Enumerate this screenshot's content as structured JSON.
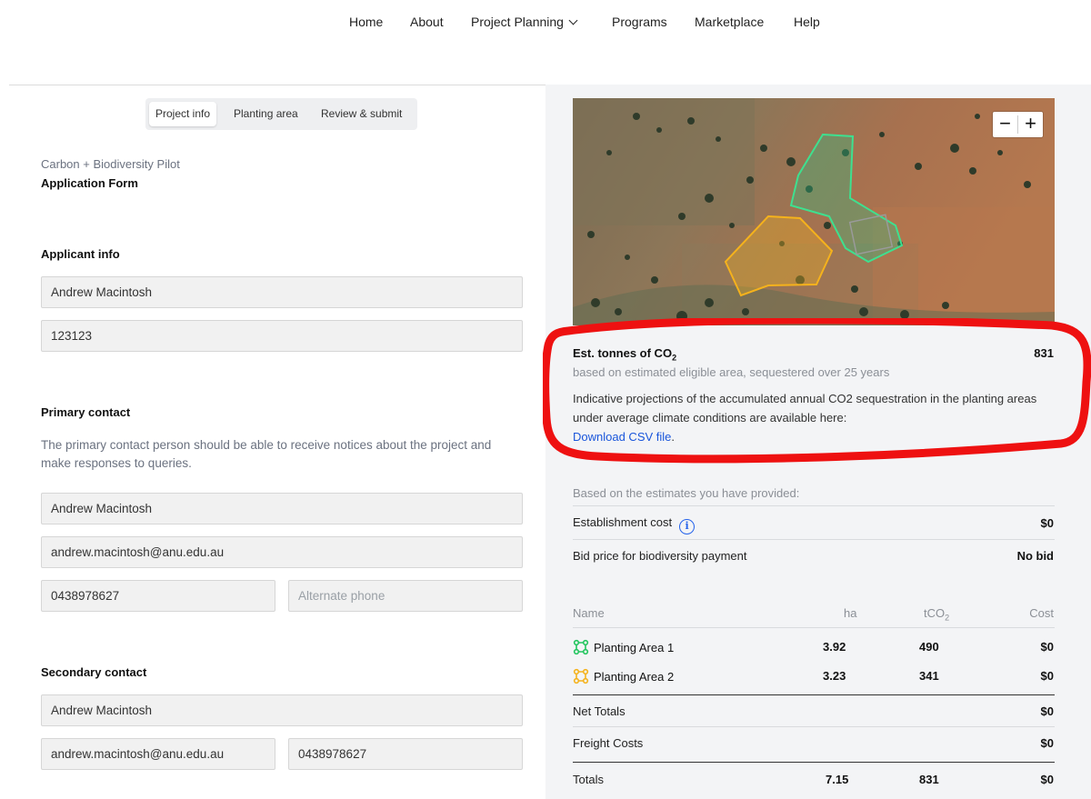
{
  "nav": {
    "home": "Home",
    "about": "About",
    "project_planning": "Project Planning",
    "programs": "Programs",
    "marketplace": "Marketplace",
    "help": "Help"
  },
  "tabs": [
    "Project info",
    "Planting area",
    "Review & submit"
  ],
  "form": {
    "subtitle": "Carbon + Biodiversity Pilot",
    "title": "Application Form"
  },
  "applicant": {
    "heading": "Applicant info",
    "name": "Andrew Macintosh",
    "id": "123123"
  },
  "primary": {
    "heading": "Primary contact",
    "help": "The primary contact person should be able to receive notices about the project and make responses to queries.",
    "name": "Andrew Macintosh",
    "email": "andrew.macintosh@anu.edu.au",
    "phone": "0438978627",
    "alt_phone_placeholder": "Alternate phone"
  },
  "secondary": {
    "heading": "Secondary contact",
    "name": "Andrew Macintosh",
    "email": "andrew.macintosh@anu.edu.au",
    "phone": "0438978627"
  },
  "map": {
    "zoom_out": "−",
    "zoom_in": "+",
    "area_colors": {
      "area1": "#34d399",
      "area2": "#fbbf24"
    }
  },
  "estimate": {
    "label": "Est. tonnes of CO",
    "label_sub": "2",
    "value": "831",
    "subtext": "based on estimated eligible area, sequestered over 25 years",
    "description": "Indicative projections of the accumulated annual CO2 sequestration in the planting areas under average climate conditions are available here:",
    "link": "Download CSV file",
    "link_suffix": "."
  },
  "summary": {
    "intro": "Based on the estimates you have provided:",
    "establishment_label": "Establishment cost",
    "establishment_value": "$0",
    "bid_label": "Bid price for biodiversity payment",
    "bid_value": "No bid"
  },
  "table": {
    "headers": {
      "name": "Name",
      "ha": "ha",
      "tco2": "tCO",
      "tco2_sub": "2",
      "cost": "Cost"
    },
    "rows": [
      {
        "name": "Planting Area 1",
        "ha": "3.92",
        "tco2": "490",
        "cost": "$0"
      },
      {
        "name": "Planting Area 2",
        "ha": "3.23",
        "tco2": "341",
        "cost": "$0"
      }
    ],
    "net_totals_label": "Net Totals",
    "net_totals_cost": "$0",
    "freight_label": "Freight Costs",
    "freight_cost": "$0",
    "totals_label": "Totals",
    "totals_ha": "7.15",
    "totals_tco2": "831",
    "totals_cost": "$0"
  },
  "colors": {
    "accent_link": "#1a56db",
    "annotation_red": "#ee1111",
    "panel_bg": "#f3f4f6"
  }
}
